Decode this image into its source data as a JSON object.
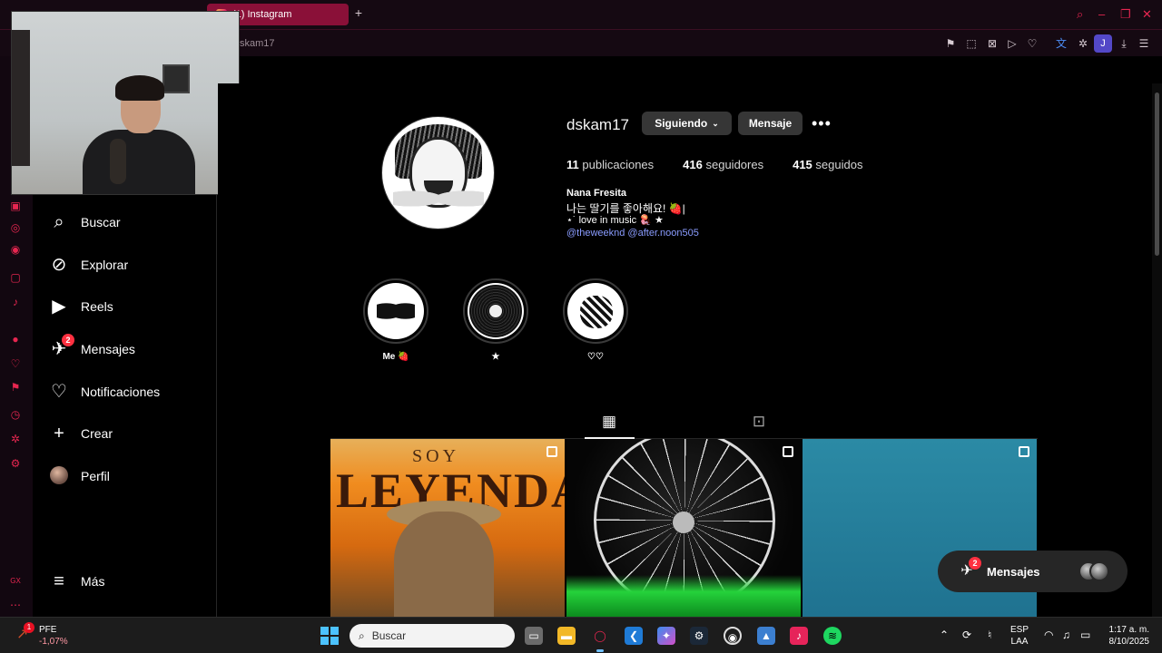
{
  "browser": {
    "active_tab_title": "(1) Instagram",
    "url_fragment": "skam17"
  },
  "sidebar": {
    "items": [
      {
        "label": "Buscar",
        "icon": "search-icon"
      },
      {
        "label": "Explorar",
        "icon": "compass-icon"
      },
      {
        "label": "Reels",
        "icon": "reels-icon"
      },
      {
        "label": "Mensajes",
        "icon": "messenger-icon",
        "badge": "2"
      },
      {
        "label": "Notificaciones",
        "icon": "heart-icon"
      },
      {
        "label": "Crear",
        "icon": "plus-icon"
      },
      {
        "label": "Perfil",
        "icon": "avatar"
      }
    ],
    "more_label": "Más"
  },
  "profile": {
    "username": "dskam17",
    "following_button": "Siguiendo",
    "message_button": "Mensaje",
    "posts_count": "11",
    "posts_label": "publicaciones",
    "followers_count": "416",
    "followers_label": "seguidores",
    "following_count": "415",
    "following_label": "seguidos",
    "full_name": "Nana Fresita",
    "bio_line1": "나는 딸기를 좋아해요! 🍓|",
    "bio_line2": "⋆˙ love in music 🪼 ★",
    "bio_links": "@theweeknd @after.noon505"
  },
  "highlights": [
    {
      "label": "Me 🍓"
    },
    {
      "label": "★"
    },
    {
      "label": "♡♡"
    }
  ],
  "posts": {
    "post1_top_text": "SOY",
    "post1_text": "LEYENDA"
  },
  "messages_pill": {
    "label": "Mensajes",
    "badge": "2"
  },
  "taskbar": {
    "stock_name": "PFE",
    "stock_change": "-1,07%",
    "stock_badge": "1",
    "search_label": "Buscar",
    "lang_line1": "ESP",
    "lang_line2": "LAA",
    "time": "1:17 a. m.",
    "date": "8/10/2025"
  },
  "colors": {
    "accent": "#e62650",
    "link": "#8a9cff",
    "badge": "#ff3040"
  }
}
